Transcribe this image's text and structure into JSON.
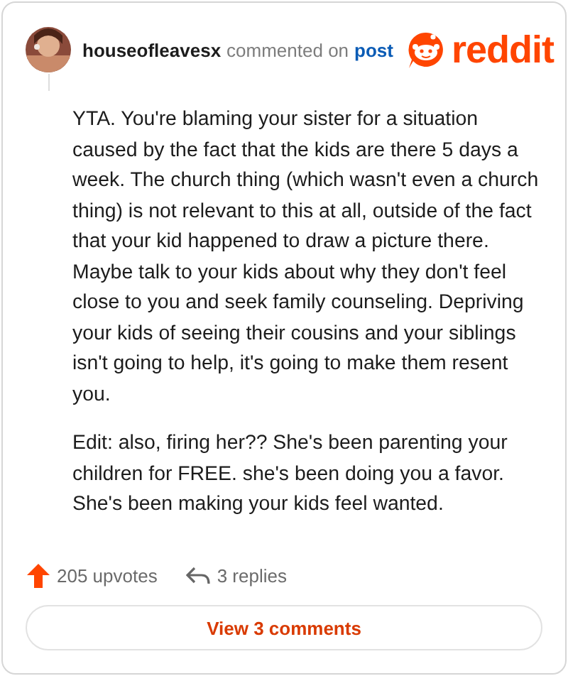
{
  "header": {
    "username": "houseofleavesx",
    "action": "commented on",
    "link": "post",
    "logo_text": "reddit"
  },
  "comment": {
    "paragraphs": [
      "YTA. You're blaming your sister for a situation caused by the fact that the kids are there 5 days a week. The church thing (which wasn't even a church thing) is not relevant to this at all, outside of the fact that your kid happened to draw a picture there. Maybe talk to your kids about why they don't feel close to you and seek family counseling. Depriving your kids of seeing their cousins and your siblings isn't going to help, it's going to make them resent you.",
      "Edit: also, firing her?? She's been parenting your children for FREE. she's been doing you a favor. She's been making your kids feel wanted."
    ]
  },
  "footer": {
    "upvotes": "205 upvotes",
    "replies": "3 replies",
    "button": "View 3 comments"
  }
}
